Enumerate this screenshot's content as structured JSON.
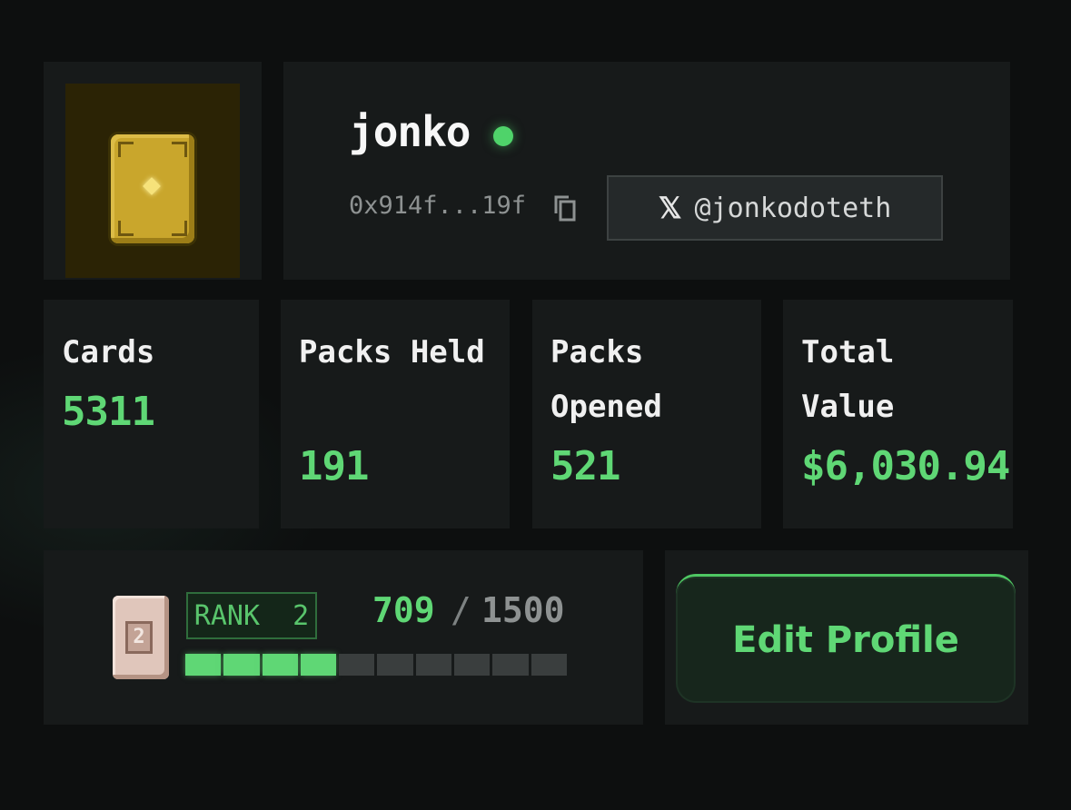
{
  "profile": {
    "username": "jonko",
    "status_color": "#4fd36a",
    "wallet": "0x914f...19f",
    "copy_icon": "copy-icon",
    "twitter_icon": "x-logo-icon",
    "twitter_handle": "@jonkodoteth",
    "avatar": "gold-card-avatar"
  },
  "stats": [
    {
      "label": "Cards",
      "value": "5311"
    },
    {
      "label": "Packs Held",
      "value": "191"
    },
    {
      "label": "Packs Opened",
      "value": "521"
    },
    {
      "label": "Total Value",
      "value": "$6,030.94"
    }
  ],
  "rank": {
    "label": "RANK  2",
    "badge_number": "2",
    "xp_current": "709",
    "xp_separator": "/",
    "xp_max": "1500",
    "progress_fraction": 0.47,
    "segments_total": 10,
    "segments_filled": 4
  },
  "actions": {
    "edit_profile": "Edit Profile"
  },
  "colors": {
    "accent": "#5fd775",
    "background": "#0d0f0f",
    "panel": "#171a1a"
  }
}
